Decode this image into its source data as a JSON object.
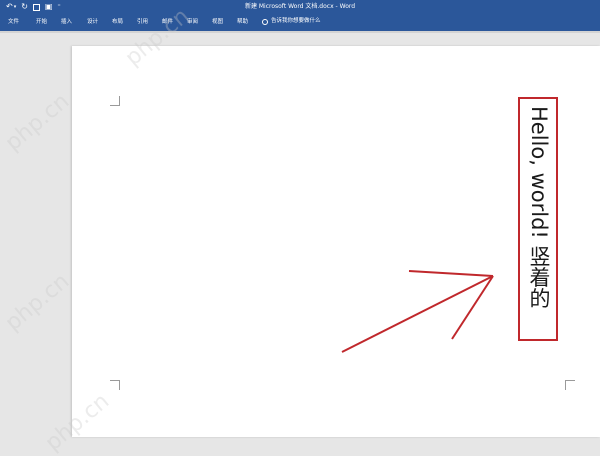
{
  "window": {
    "title": "新建 Microsoft Word 文档.docx - Word"
  },
  "quick_access": {
    "undo_glyph": "↶",
    "dropdown_glyph": "▾",
    "redo_glyph": "↻",
    "touch_glyph": "▣",
    "more_glyph": "⁼"
  },
  "menu": {
    "tabs": [
      "文件",
      "开始",
      "插入",
      "设计",
      "布局",
      "引用",
      "邮件",
      "审阅",
      "视图",
      "帮助"
    ],
    "tell_me": "告诉我你想要做什么"
  },
  "document": {
    "vertical_text": "Hello, world! 竖着的"
  },
  "watermark": "php.cn",
  "colors": {
    "ribbon_blue": "#2b579a",
    "annotation_red": "#c0282c",
    "page_bg": "#ffffff",
    "workspace_bg": "#e6e6e6"
  }
}
